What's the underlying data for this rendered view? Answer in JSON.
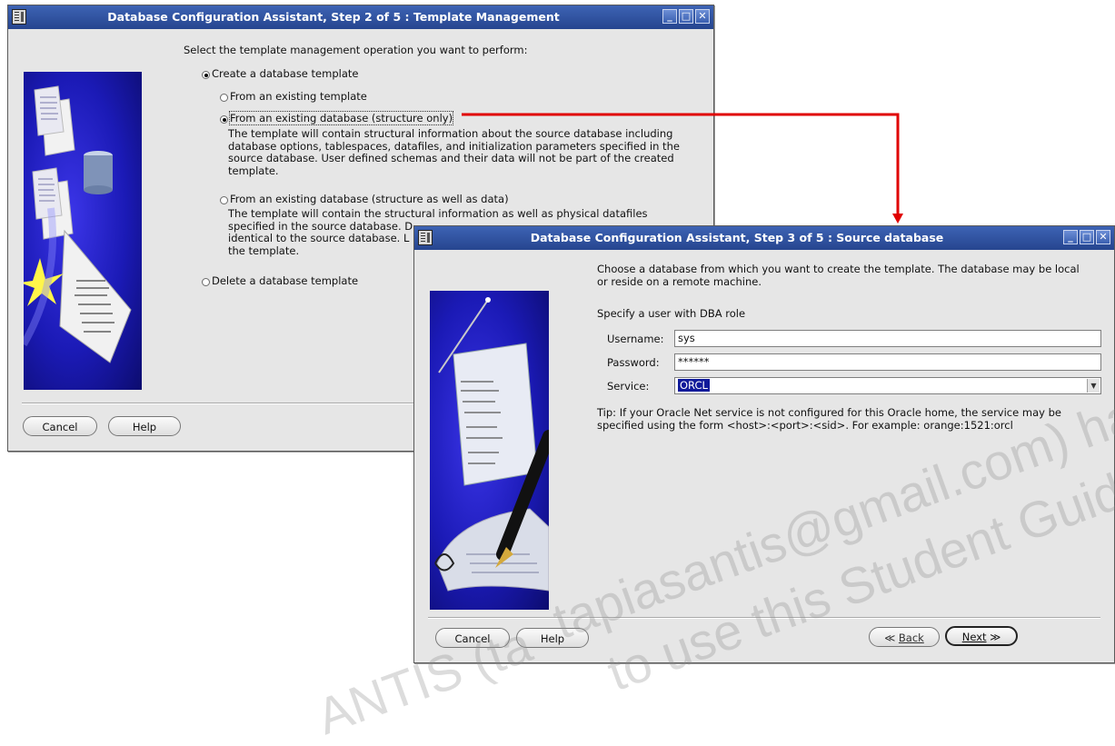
{
  "colors": {
    "titlebar": "#2f52a3",
    "window_bg": "#e6e6e6",
    "connector": "#e00000",
    "selection": "#101a9a"
  },
  "window1": {
    "title": "Database Configuration Assistant, Step 2 of 5 : Template Management",
    "prompt": "Select the template management operation you want to perform:",
    "create_option": "Create a database template",
    "sub_options": [
      {
        "label": "From an existing template",
        "selected": false
      },
      {
        "label": "From an existing database (structure only)",
        "selected": true,
        "description": "The template will contain structural information about the source database including database options, tablespaces, datafiles, and initialization parameters specified in the source database. User defined schemas and their data will not be part of the created template."
      },
      {
        "label": "From an existing database (structure as well as data)",
        "selected": false,
        "description_lines": [
          "The template will contain the structural information as well as physical datafiles",
          "specified in the source database. D",
          "identical to the source database. L",
          "the template."
        ]
      }
    ],
    "delete_option": "Delete a database template",
    "cancel_label": "Cancel",
    "help_label": "Help"
  },
  "window2": {
    "title": "Database Configuration Assistant, Step 3 of 5 : Source database",
    "intro": "Choose a database from which you want to create the template. The database may be local or reside on a remote machine.",
    "dba_heading": "Specify a user with DBA role",
    "username_label": "Username:",
    "username_value": "sys",
    "password_label": "Password:",
    "password_value": "******",
    "service_label": "Service:",
    "service_value": "ORCL",
    "tip": "Tip: If your Oracle Net service is not configured for this Oracle home, the service may be specified using the form <host>:<port>:<sid>. For example: orange:1521:orcl",
    "cancel_label": "Cancel",
    "help_label": "Help",
    "back_label": "Back",
    "next_label": "Next"
  },
  "watermark": {
    "line1": "tapiasantis@gmail.com) has a",
    "line2": "to use this Student Guide.",
    "line3": "ANTIS (ta"
  },
  "icons": [
    "window-menu-icon",
    "minimize-icon",
    "maximize-icon",
    "close-icon",
    "chevron-left-icon",
    "chevron-right-icon",
    "dropdown-arrow-icon",
    "connector-arrow-icon"
  ]
}
